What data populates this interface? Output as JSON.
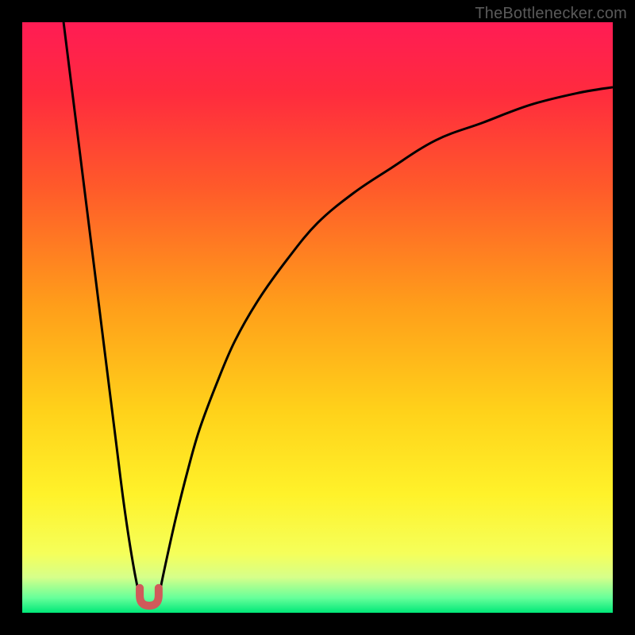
{
  "watermark": "TheBottlenecker.com",
  "colors": {
    "frame": "#000000",
    "gradient_stops": [
      {
        "offset": 0.0,
        "color": "#ff1c54"
      },
      {
        "offset": 0.12,
        "color": "#ff2b3e"
      },
      {
        "offset": 0.28,
        "color": "#ff5a2a"
      },
      {
        "offset": 0.48,
        "color": "#ff9e1a"
      },
      {
        "offset": 0.66,
        "color": "#ffd21a"
      },
      {
        "offset": 0.8,
        "color": "#fff22a"
      },
      {
        "offset": 0.9,
        "color": "#f5ff5a"
      },
      {
        "offset": 0.94,
        "color": "#d6ff8a"
      },
      {
        "offset": 0.975,
        "color": "#66ff9a"
      },
      {
        "offset": 1.0,
        "color": "#00e878"
      }
    ],
    "curve": "#000000",
    "marker_fill": "#d05a5a",
    "marker_stroke": "#b84a4a"
  },
  "chart_data": {
    "type": "line",
    "title": "",
    "xlabel": "",
    "ylabel": "",
    "xlim": [
      0,
      100
    ],
    "ylim": [
      0,
      100
    ],
    "grid": false,
    "legend": false,
    "series": [
      {
        "name": "left-branch",
        "x": [
          7,
          8,
          9,
          10,
          11,
          12,
          13,
          14,
          15,
          16,
          17,
          18,
          19,
          20
        ],
        "y": [
          100,
          92,
          84,
          76,
          68,
          60,
          52,
          44,
          36,
          28,
          20,
          13,
          7,
          2
        ]
      },
      {
        "name": "right-branch",
        "x": [
          23,
          24,
          26,
          28,
          30,
          33,
          36,
          40,
          45,
          50,
          56,
          62,
          70,
          78,
          86,
          94,
          100
        ],
        "y": [
          2,
          7,
          16,
          24,
          31,
          39,
          46,
          53,
          60,
          66,
          71,
          75,
          80,
          83,
          86,
          88,
          89
        ]
      }
    ],
    "marker": {
      "x_center": 21.5,
      "x_halfwidth": 1.6,
      "y_bottom": 1.2,
      "y_top": 4.2
    }
  }
}
